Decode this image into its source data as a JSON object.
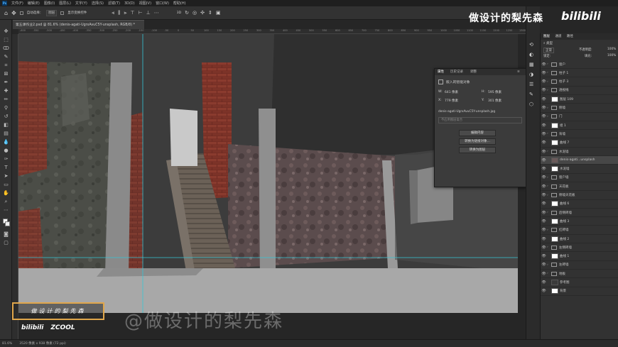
{
  "menubar": {
    "items": [
      "文件(F)",
      "编辑(E)",
      "图像(I)",
      "图层(L)",
      "文字(Y)",
      "选择(S)",
      "滤镜(T)",
      "3D(D)",
      "视图(V)",
      "窗口(W)",
      "帮助(H)"
    ]
  },
  "options": {
    "auto_select": "自动选择：",
    "auto_select_target": "图层",
    "show_transform": "显示变换控件"
  },
  "document": {
    "tab_title": "第五课作业2.psd @ 81.6% (denis-agati-UgrxAvuC5Y-unsplash, RGB/8) *"
  },
  "ruler": {
    "top_ticks": [
      "-600",
      "-550",
      "-500",
      "-450",
      "-400",
      "-350",
      "-300",
      "-250",
      "-200",
      "-150",
      "-100",
      "-50",
      "0",
      "50",
      "100",
      "150",
      "200",
      "250",
      "300",
      "350",
      "400",
      "450",
      "500",
      "550",
      "600",
      "650",
      "700",
      "750",
      "800",
      "850",
      "900",
      "950",
      "1000",
      "1050",
      "1100",
      "1150",
      "1200",
      "1250",
      "1300"
    ]
  },
  "properties": {
    "tabs": [
      "属性",
      "历史记录",
      "调整"
    ],
    "header": "嵌入的智能对象",
    "w_label": "W:",
    "w_value": "641 像素",
    "h_label": "H:",
    "h_value": "595 像素",
    "x_label": "X:",
    "x_value": "779 像素",
    "y_label": "Y:",
    "y_value": "301 像素",
    "filename": "denis-agati-UgrxAvuC5Y-unsplash.jpg",
    "comp_placeholder": "不应用图层复合",
    "btn_edit": "编辑内容",
    "btn_linked": "转换为链接对象...",
    "btn_layers": "转换为图层"
  },
  "layers_panel": {
    "tabs": [
      "图层",
      "通道",
      "路径"
    ],
    "kind_filter": "类型",
    "blend_mode": "正常",
    "opacity_label": "不透明度:",
    "opacity_value": "100%",
    "lock_label": "锁定:",
    "fill_label": "填充:",
    "fill_value": "100%",
    "items": [
      {
        "name": "窗户",
        "type": "group"
      },
      {
        "name": "柱子 1",
        "type": "group"
      },
      {
        "name": "柱子 3",
        "type": "group"
      },
      {
        "name": "透视线",
        "type": "group"
      },
      {
        "name": "图层 109",
        "type": "layer"
      },
      {
        "name": "侧墙",
        "type": "group"
      },
      {
        "name": "门",
        "type": "group"
      },
      {
        "name": "组 1",
        "type": "layer"
      },
      {
        "name": "背墙",
        "type": "group"
      },
      {
        "name": "曲线 7",
        "type": "adjust"
      },
      {
        "name": "水泥墙",
        "type": "group"
      },
      {
        "name": "denis-agati...unsplash",
        "type": "smart"
      },
      {
        "name": "水泥墙",
        "type": "layer"
      },
      {
        "name": "窗户墙",
        "type": "group"
      },
      {
        "name": "天花板",
        "type": "group"
      },
      {
        "name": "侧墙天花板",
        "type": "group"
      },
      {
        "name": "曲线 6",
        "type": "adjust"
      },
      {
        "name": "后侧砖墙",
        "type": "group"
      },
      {
        "name": "曲线 3",
        "type": "adjust"
      },
      {
        "name": "红砖墙",
        "type": "group"
      },
      {
        "name": "曲线 2",
        "type": "adjust"
      },
      {
        "name": "左侧砖墙",
        "type": "group"
      },
      {
        "name": "曲线 1",
        "type": "adjust"
      },
      {
        "name": "左砖墙",
        "type": "group"
      },
      {
        "name": "地板",
        "type": "group"
      },
      {
        "name": "参考图",
        "type": "layer"
      },
      {
        "name": "背景",
        "type": "layer"
      }
    ]
  },
  "status": {
    "zoom": "81.6%",
    "doc_info": "3520 像素 x 938 像素 (72 ppi)"
  },
  "overlay": {
    "brand_text": "做设计的梨先森",
    "bili_logo": "bilibili",
    "watermark": "@做设计的梨先森",
    "caption": "做设计的梨先森",
    "logo_bili": "bilibili",
    "logo_zcool": "ZCOOL"
  },
  "colors": {
    "accent_orange": "#e0a64b",
    "guide_cyan": "#35c6d6",
    "brick_red": "#7a2f26"
  }
}
